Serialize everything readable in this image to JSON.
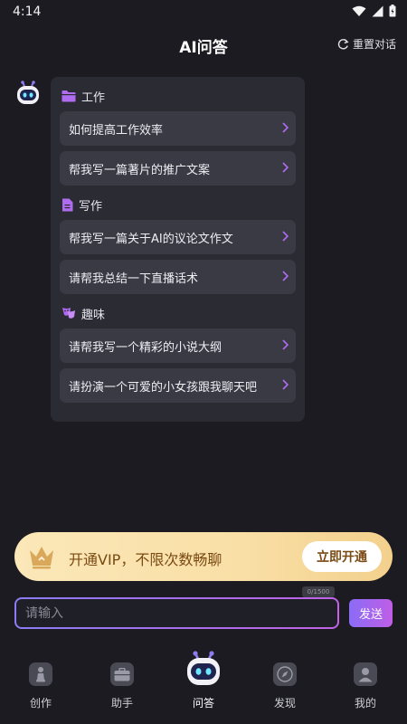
{
  "status_bar": {
    "time": "4:14"
  },
  "header": {
    "title": "AI问答",
    "reset_label": "重置对话"
  },
  "sections": [
    {
      "title": "工作",
      "icon": "folder-icon",
      "items": [
        "如何提高工作效率",
        "帮我写一篇著片的推广文案"
      ]
    },
    {
      "title": "写作",
      "icon": "document-icon",
      "items": [
        "帮我写一篇关于AI的议论文作文",
        "请帮我总结一下直播话术"
      ]
    },
    {
      "title": "趣味",
      "icon": "theater-mask-icon",
      "items": [
        "请帮我写一个精彩的小说大纲",
        "请扮演一个可爱的小女孩跟我聊天吧"
      ]
    }
  ],
  "vip": {
    "text": "开通VIP，不限次数畅聊",
    "button": "立即开通"
  },
  "input": {
    "placeholder": "请输入",
    "counter": "0/1500",
    "send_label": "发送"
  },
  "bottom_nav": [
    {
      "label": "创作",
      "icon": "chess-piece-icon"
    },
    {
      "label": "助手",
      "icon": "briefcase-icon"
    },
    {
      "label": "问答",
      "icon": "robot-icon",
      "active": true
    },
    {
      "label": "发现",
      "icon": "compass-icon"
    },
    {
      "label": "我的",
      "icon": "user-icon"
    }
  ],
  "colors": {
    "background": "#1b1b21",
    "card": "#2b2b34",
    "item": "#3a3a45",
    "accent": "#b06cf0",
    "vip_gold": "#f9dfa6",
    "vip_text": "#7a4a13"
  }
}
